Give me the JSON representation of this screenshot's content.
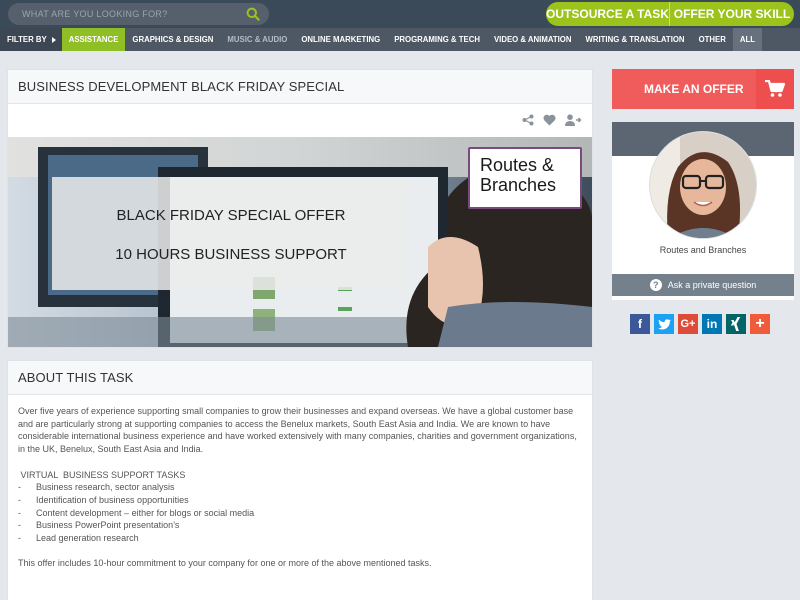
{
  "search": {
    "placeholder": "WHAT ARE YOU LOOKING FOR?"
  },
  "header": {
    "outsource_label": "OUTSOURCE A TASK",
    "offer_label": "OFFER YOUR SKILL"
  },
  "categories": {
    "filter_label": "FILTER BY",
    "items": [
      "ASSISTANCE",
      "GRAPHICS & DESIGN",
      "MUSIC & AUDIO",
      "ONLINE MARKETING",
      "PROGRAMING & TECH",
      "VIDEO & ANIMATION",
      "WRITING & TRANSLATION",
      "OTHER",
      "ALL"
    ],
    "active": "ASSISTANCE"
  },
  "task": {
    "title": "BUSINESS DEVELOPMENT BLACK FRIDAY SPECIAL",
    "hero_line1": "BLACK FRIDAY SPECIAL OFFER",
    "hero_line2": "10 HOURS BUSINESS SUPPORT",
    "logo_line1": "Routes &",
    "logo_line2": "Branches"
  },
  "about": {
    "heading": "ABOUT THIS TASK",
    "intro": "Over five years of experience supporting small companies to grow their businesses and expand overseas.  We have a global customer base and are particularly strong at supporting companies to access the Benelux markets, South East Asia and India. We are known to have considerable international business experience and have worked extensively with many companies, charities and government organizations, in the UK, Benelux, South East Asia and India.",
    "list_title": " VIRTUAL  BUSINESS SUPPORT TASKS",
    "list": [
      "Business research, sector analysis",
      "Identification of business opportunities",
      "Content development – either for blogs or social media",
      "Business PowerPoint presentation’s",
      "Lead generation research"
    ],
    "closing": "This offer includes 10-hour commitment to your company for one or more of the above mentioned tasks."
  },
  "sidebar": {
    "make_offer_label": "MAKE AN OFFER",
    "seller_name": "Routes and Branches",
    "ask_label": "Ask a private question"
  },
  "social": [
    {
      "icon": "facebook-icon",
      "glyph": "f",
      "color": "#3b5998"
    },
    {
      "icon": "twitter-icon",
      "glyph": "t",
      "color": "#1da1f2"
    },
    {
      "icon": "google-plus-icon",
      "glyph": "G+",
      "color": "#dd4b39"
    },
    {
      "icon": "linkedin-icon",
      "glyph": "in",
      "color": "#0077b5"
    },
    {
      "icon": "xing-icon",
      "glyph": "X",
      "color": "#026466"
    },
    {
      "icon": "more-share-icon",
      "glyph": "+",
      "color": "#f05b39"
    }
  ],
  "colors": {
    "accent_green": "#9bc31c",
    "offer_red": "#f05b5b",
    "topbar": "#3b4a59"
  }
}
